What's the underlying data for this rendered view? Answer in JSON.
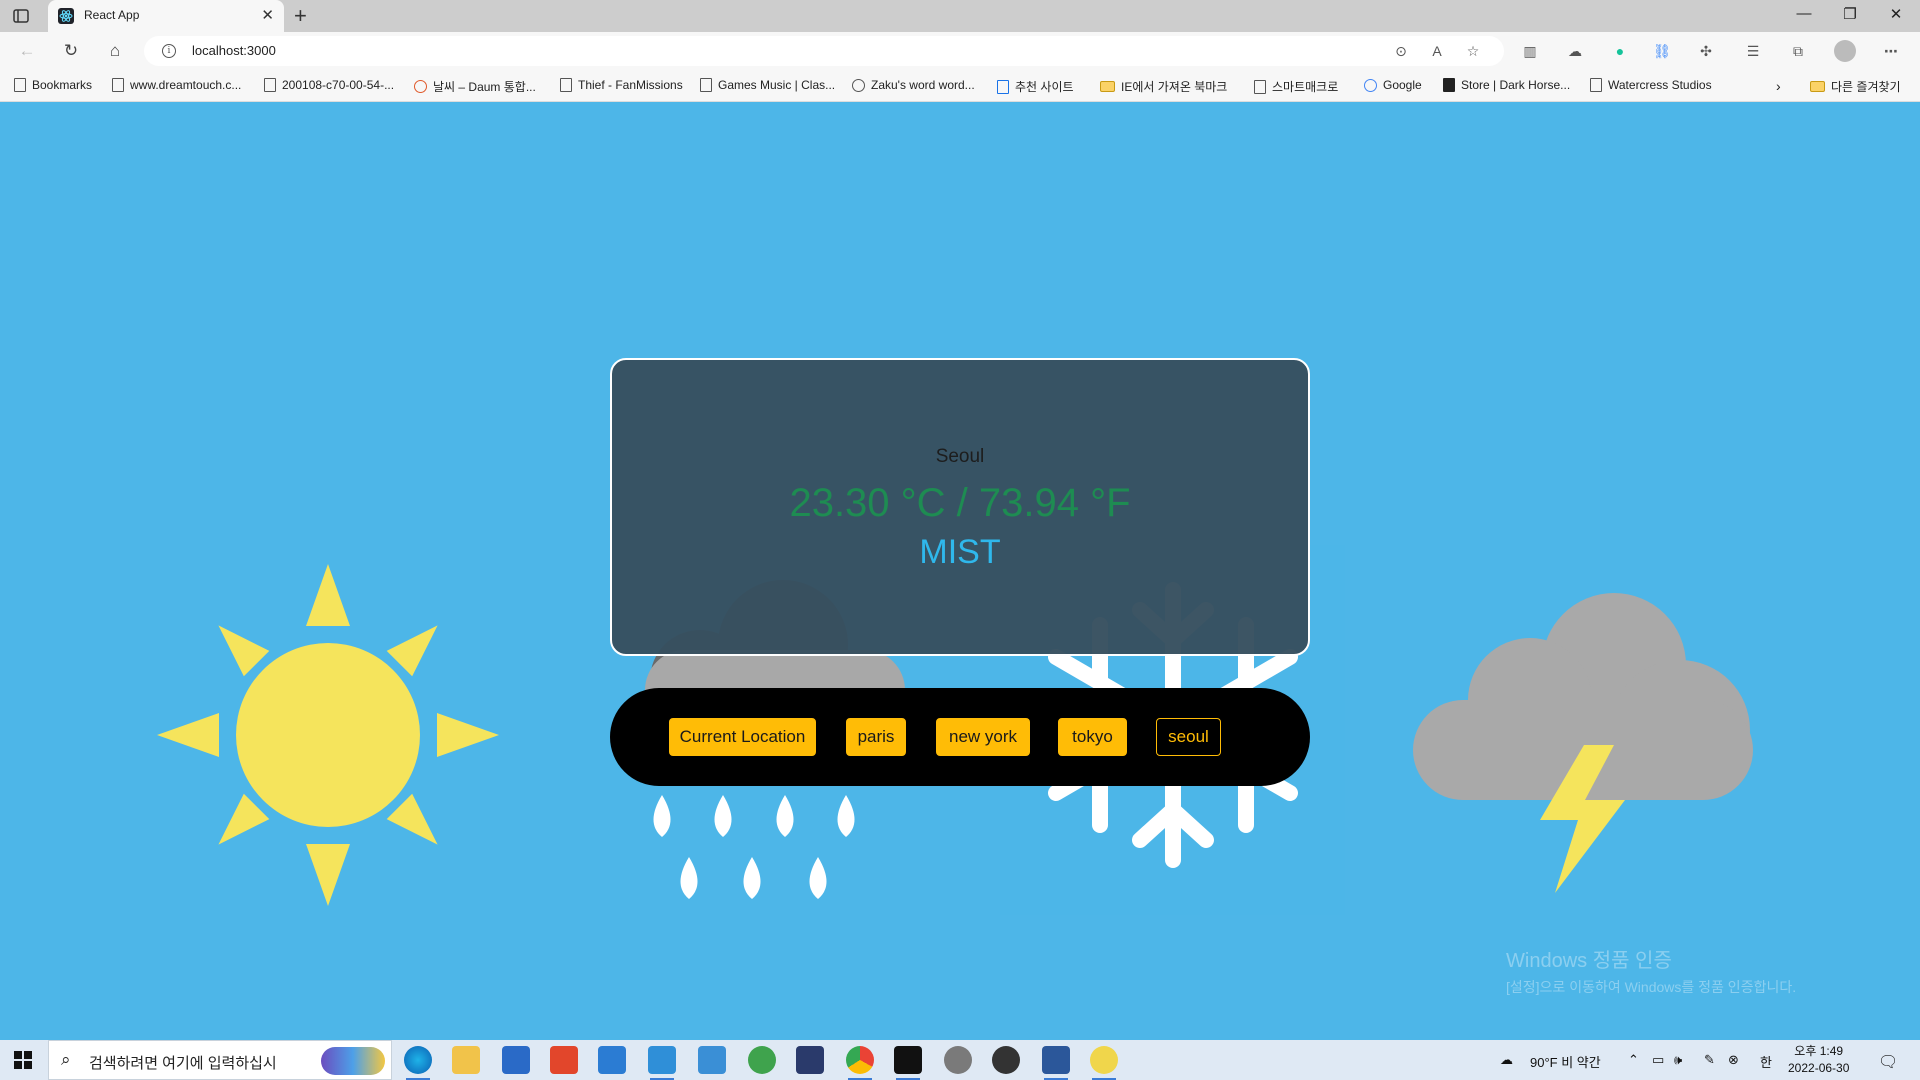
{
  "browser": {
    "tab_title": "React App",
    "url": "localhost:3000",
    "bookmarks": [
      {
        "label": "Bookmarks",
        "icon": "bookmarks-icon"
      },
      {
        "label": "www.dreamtouch.c...",
        "icon": "page-icon"
      },
      {
        "label": "200108-c70-00-54-...",
        "icon": "page-icon"
      },
      {
        "label": "날씨 – Daum 통합...",
        "icon": "daum-icon"
      },
      {
        "label": "Thief - FanMissions",
        "icon": "page-icon"
      },
      {
        "label": "Games Music | Clas...",
        "icon": "games-icon"
      },
      {
        "label": "Zaku's word word...",
        "icon": "wordpress-icon"
      },
      {
        "label": "추천 사이트",
        "icon": "bing-icon"
      },
      {
        "label": "IE에서 가져온 북마크",
        "icon": "folder-icon"
      },
      {
        "label": "스마트매크로",
        "icon": "page-icon"
      },
      {
        "label": "Google",
        "icon": "google-icon"
      },
      {
        "label": "Store | Dark Horse...",
        "icon": "darkhorse-icon"
      },
      {
        "label": "Watercress Studios",
        "icon": "page-icon"
      }
    ],
    "other_bookmarks": "다른 즐겨찾기"
  },
  "weather": {
    "city": "Seoul",
    "temperature": "23.30 °C / 73.94 °F",
    "description": "MIST"
  },
  "city_buttons": [
    {
      "label": "Current Location",
      "selected": false
    },
    {
      "label": "paris",
      "selected": false
    },
    {
      "label": "new york",
      "selected": false
    },
    {
      "label": "tokyo",
      "selected": false
    },
    {
      "label": "seoul",
      "selected": true
    }
  ],
  "watermark": {
    "line1": "Windows 정품 인증",
    "line2": "[설정]으로 이동하여 Windows를 정품 인증합니다."
  },
  "taskbar": {
    "search_placeholder": "검색하려면 여기에 입력하십시",
    "weather": "90°F  비 약간",
    "ime": "한",
    "time": "오후 1:49",
    "date": "2022-06-30"
  },
  "colors": {
    "page_background": "#4db6e8",
    "button_accent": "#ffbc06",
    "temperature_text": "#1e8c52",
    "description_text": "#2fb8ec",
    "sun": "#f5e45c"
  }
}
